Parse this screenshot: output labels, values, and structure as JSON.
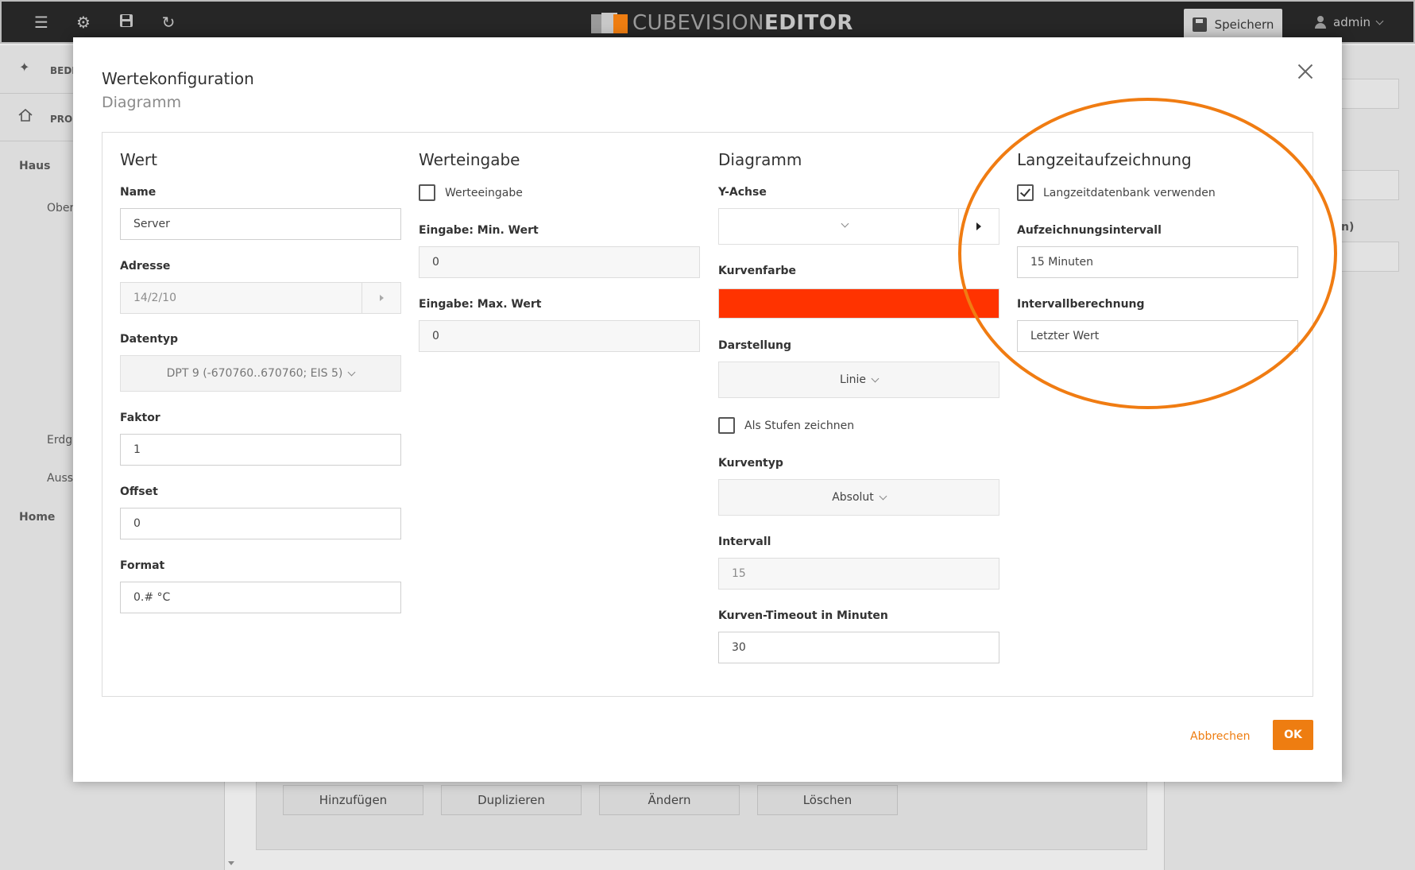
{
  "app": {
    "logo_light": "CUBEVISION",
    "logo_bold": "EDITOR",
    "save_label": "Speichern",
    "user_label": "admin"
  },
  "background": {
    "left_items": [
      "BEDI",
      "PRO",
      "Haus",
      "Ober",
      "Erdg",
      "Auss",
      "Home"
    ],
    "right_label": "n)",
    "buttons": [
      "Hinzufügen",
      "Duplizieren",
      "Ändern",
      "Löschen"
    ]
  },
  "modal": {
    "title": "Wertekonfiguration",
    "subtitle": "Diagramm",
    "cancel_label": "Abbrechen",
    "ok_label": "OK"
  },
  "wert": {
    "title": "Wert",
    "name_label": "Name",
    "name_value": "Server",
    "adresse_label": "Adresse",
    "adresse_value": "14/2/10",
    "datentyp_label": "Datentyp",
    "datentyp_value": "DPT 9 (-670760..670760; EIS 5)",
    "faktor_label": "Faktor",
    "faktor_value": "1",
    "offset_label": "Offset",
    "offset_value": "0",
    "format_label": "Format",
    "format_value": "0.# °C"
  },
  "werteingabe": {
    "title": "Werteingabe",
    "checkbox_label": "Werteeingabe",
    "checkbox_checked": false,
    "min_label": "Eingabe: Min. Wert",
    "min_value": "0",
    "max_label": "Eingabe: Max. Wert",
    "max_value": "0"
  },
  "diagramm": {
    "title": "Diagramm",
    "yachse_label": "Y-Achse",
    "yachse_value": "",
    "kurvenfarbe_label": "Kurvenfarbe",
    "kurvenfarbe_color": "#ff3300",
    "darstellung_label": "Darstellung",
    "darstellung_value": "Linie",
    "stufen_label": "Als Stufen zeichnen",
    "stufen_checked": false,
    "kurventyp_label": "Kurventyp",
    "kurventyp_value": "Absolut",
    "intervall_label": "Intervall",
    "intervall_value": "15",
    "timeout_label": "Kurven-Timeout in Minuten",
    "timeout_value": "30"
  },
  "langzeit": {
    "title": "Langzeitaufzeichnung",
    "checkbox_label": "Langzeitdatenbank verwenden",
    "checkbox_checked": true,
    "intervall_label": "Aufzeichnungsintervall",
    "intervall_value": "15 Minuten",
    "berechnung_label": "Intervallberechnung",
    "berechnung_value": "Letzter Wert"
  },
  "colors": {
    "accent": "#ee7d11",
    "highlight_ring": "#f07c12",
    "topbar": "#262626"
  }
}
